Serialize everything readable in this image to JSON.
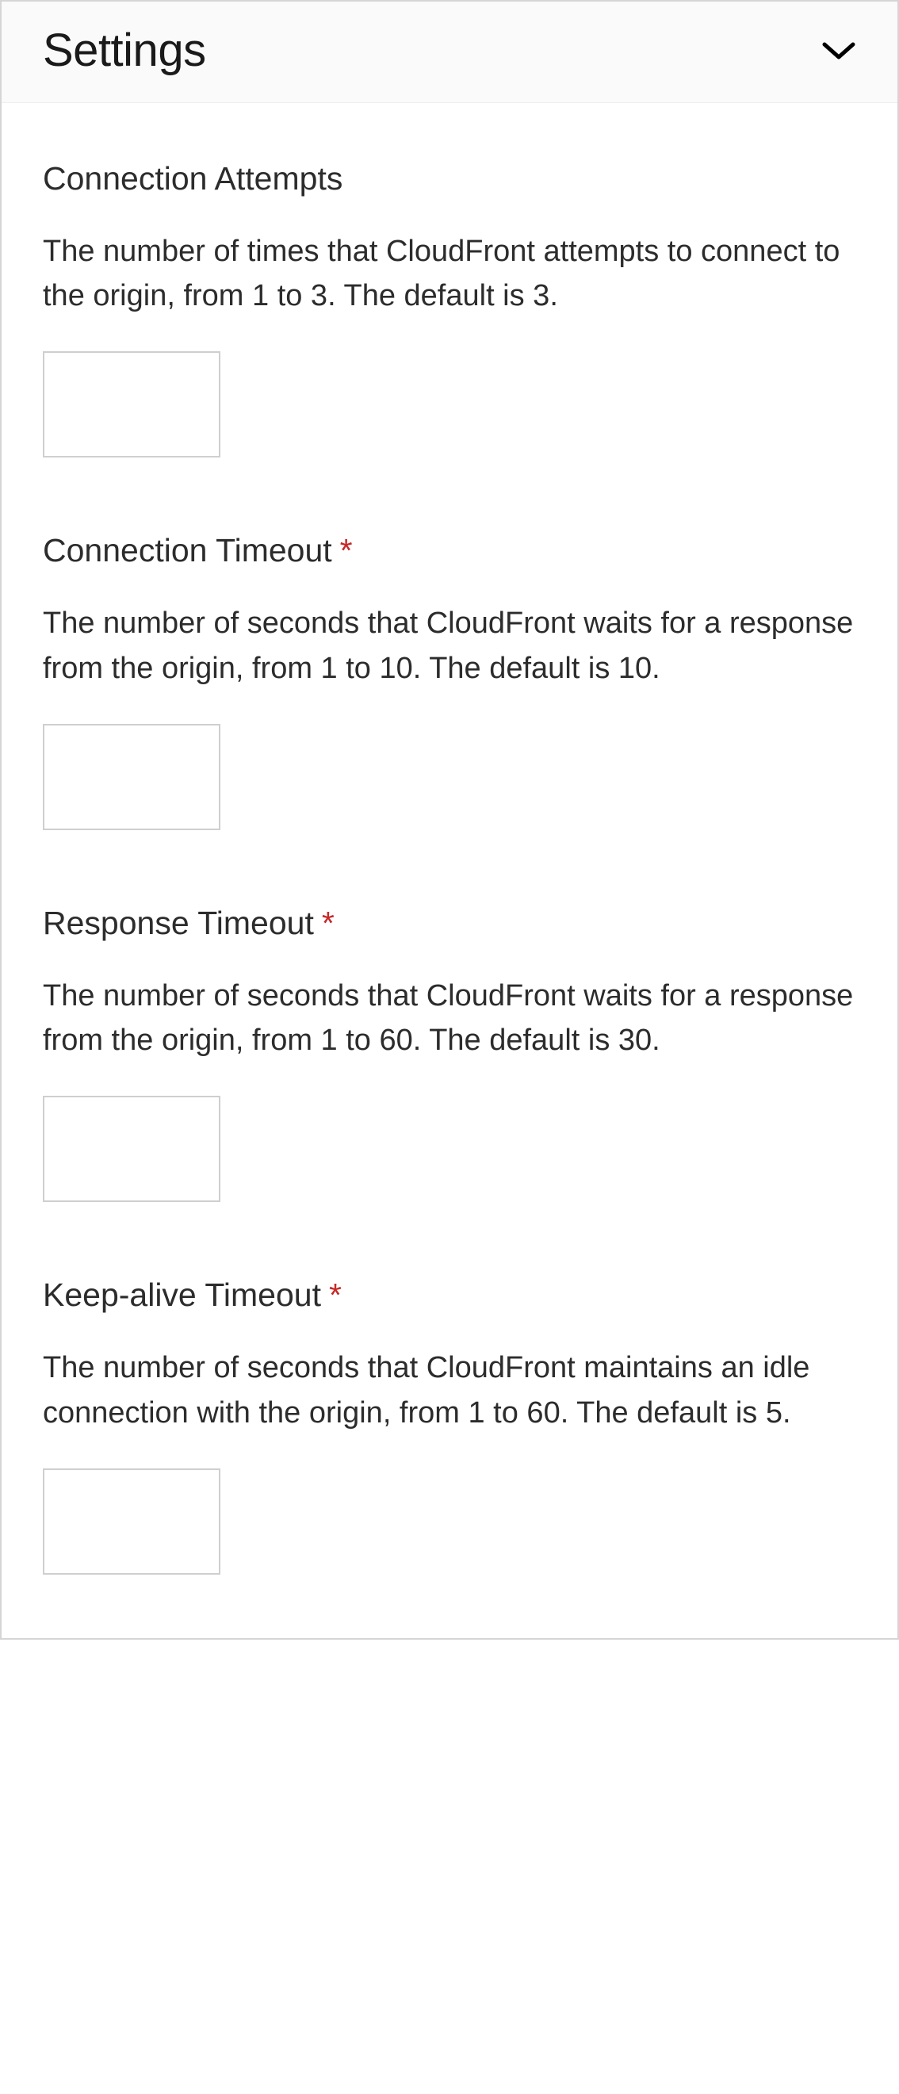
{
  "header": {
    "title": "Settings"
  },
  "fields": [
    {
      "label": "Connection Attempts",
      "required": false,
      "description": "The number of times that CloudFront attempts to connect to the origin, from 1 to 3. The default is 3.",
      "value": ""
    },
    {
      "label": "Connection Timeout",
      "required": true,
      "description": "The number of seconds that CloudFront waits for a response from the origin, from 1 to 10. The default is 10.",
      "value": ""
    },
    {
      "label": "Response Timeout",
      "required": true,
      "description": "The number of seconds that CloudFront waits for a response from the origin, from 1 to 60. The default is 30.",
      "value": ""
    },
    {
      "label": "Keep-alive Timeout",
      "required": true,
      "description": "The number of seconds that CloudFront maintains an idle connection with the origin, from 1 to 60. The default is 5.",
      "value": ""
    }
  ]
}
